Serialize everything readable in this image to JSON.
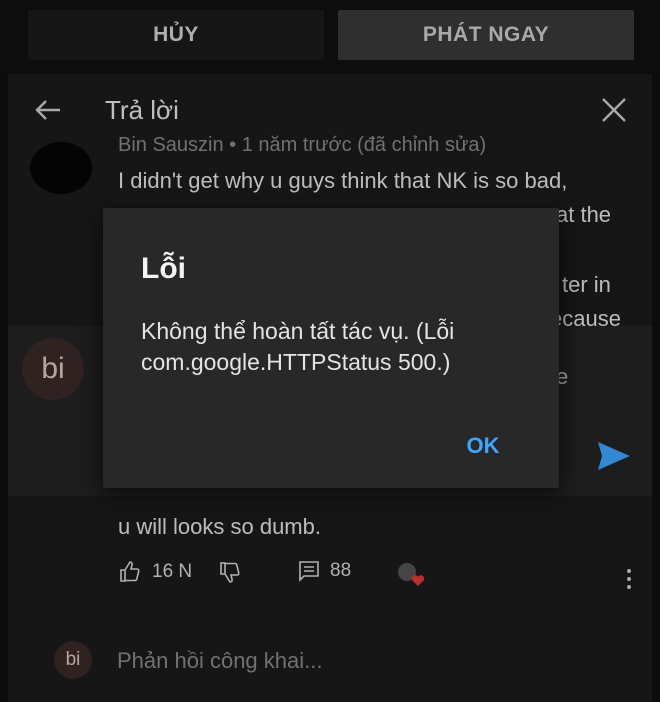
{
  "top": {
    "cancel_label": "HỦY",
    "publish_label": "PHÁT NGAY"
  },
  "sheet": {
    "title": "Trả lời"
  },
  "comment": {
    "meta": "Bin Sauszin • 1 năm trước (đã chỉnh sửa)",
    "lines": [
      "I didn't get why u guys think that NK is so bad,",
      "at the",
      "ter in",
      "ecause",
      "e",
      "u will looks so dumb."
    ],
    "likes": "16 N",
    "replies": "88"
  },
  "composer": {
    "avatar_letter": "bi"
  },
  "reply": {
    "avatar_letter": "bi",
    "placeholder": "Phản hồi công khai..."
  },
  "dialog": {
    "title": "Lỗi",
    "message": "Không thể hoàn tất tác vụ. (Lỗi com.google.HTTPStatus 500.)",
    "ok_label": "OK"
  },
  "colors": {
    "accent": "#3ea6ff",
    "background": "#0f0f0f",
    "dialog": "#282828"
  }
}
